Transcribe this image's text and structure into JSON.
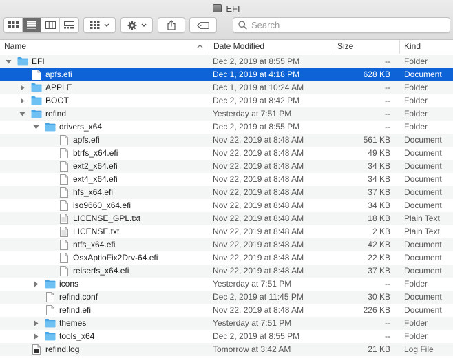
{
  "window": {
    "title": "EFI"
  },
  "toolbar": {
    "search_placeholder": "Search"
  },
  "columns": {
    "name": "Name",
    "date": "Date Modified",
    "size": "Size",
    "kind": "Kind"
  },
  "accent": "#0e63d6",
  "rows": [
    {
      "name": "EFI",
      "date": "Dec 2, 2019 at 8:55 PM",
      "size": "--",
      "kind": "Folder",
      "level": 0,
      "type": "folder",
      "expand": "open"
    },
    {
      "name": "apfs.efi",
      "date": "Dec 1, 2019 at 4:18 PM",
      "size": "628 KB",
      "kind": "Document",
      "level": 1,
      "type": "doc",
      "expand": "none",
      "selected": true
    },
    {
      "name": "APPLE",
      "date": "Dec 1, 2019 at 10:24 AM",
      "size": "--",
      "kind": "Folder",
      "level": 1,
      "type": "folder",
      "expand": "closed"
    },
    {
      "name": "BOOT",
      "date": "Dec 2, 2019 at 8:42 PM",
      "size": "--",
      "kind": "Folder",
      "level": 1,
      "type": "folder",
      "expand": "closed"
    },
    {
      "name": "refind",
      "date": "Yesterday at 7:51 PM",
      "size": "--",
      "kind": "Folder",
      "level": 1,
      "type": "folder",
      "expand": "open"
    },
    {
      "name": "drivers_x64",
      "date": "Dec 2, 2019 at 8:55 PM",
      "size": "--",
      "kind": "Folder",
      "level": 2,
      "type": "folder",
      "expand": "open"
    },
    {
      "name": "apfs.efi",
      "date": "Nov 22, 2019 at 8:48 AM",
      "size": "561 KB",
      "kind": "Document",
      "level": 3,
      "type": "doc",
      "expand": "none"
    },
    {
      "name": "btrfs_x64.efi",
      "date": "Nov 22, 2019 at 8:48 AM",
      "size": "49 KB",
      "kind": "Document",
      "level": 3,
      "type": "doc",
      "expand": "none"
    },
    {
      "name": "ext2_x64.efi",
      "date": "Nov 22, 2019 at 8:48 AM",
      "size": "34 KB",
      "kind": "Document",
      "level": 3,
      "type": "doc",
      "expand": "none"
    },
    {
      "name": "ext4_x64.efi",
      "date": "Nov 22, 2019 at 8:48 AM",
      "size": "34 KB",
      "kind": "Document",
      "level": 3,
      "type": "doc",
      "expand": "none"
    },
    {
      "name": "hfs_x64.efi",
      "date": "Nov 22, 2019 at 8:48 AM",
      "size": "37 KB",
      "kind": "Document",
      "level": 3,
      "type": "doc",
      "expand": "none"
    },
    {
      "name": "iso9660_x64.efi",
      "date": "Nov 22, 2019 at 8:48 AM",
      "size": "34 KB",
      "kind": "Document",
      "level": 3,
      "type": "doc",
      "expand": "none"
    },
    {
      "name": "LICENSE_GPL.txt",
      "date": "Nov 22, 2019 at 8:48 AM",
      "size": "18 KB",
      "kind": "Plain Text",
      "level": 3,
      "type": "text",
      "expand": "none"
    },
    {
      "name": "LICENSE.txt",
      "date": "Nov 22, 2019 at 8:48 AM",
      "size": "2 KB",
      "kind": "Plain Text",
      "level": 3,
      "type": "text",
      "expand": "none"
    },
    {
      "name": "ntfs_x64.efi",
      "date": "Nov 22, 2019 at 8:48 AM",
      "size": "42 KB",
      "kind": "Document",
      "level": 3,
      "type": "doc",
      "expand": "none"
    },
    {
      "name": "OsxAptioFix2Drv-64.efi",
      "date": "Nov 22, 2019 at 8:48 AM",
      "size": "22 KB",
      "kind": "Document",
      "level": 3,
      "type": "doc",
      "expand": "none"
    },
    {
      "name": "reiserfs_x64.efi",
      "date": "Nov 22, 2019 at 8:48 AM",
      "size": "37 KB",
      "kind": "Document",
      "level": 3,
      "type": "doc",
      "expand": "none"
    },
    {
      "name": "icons",
      "date": "Yesterday at 7:51 PM",
      "size": "--",
      "kind": "Folder",
      "level": 2,
      "type": "folder",
      "expand": "closed"
    },
    {
      "name": "refind.conf",
      "date": "Dec 2, 2019 at 11:45 PM",
      "size": "30 KB",
      "kind": "Document",
      "level": 2,
      "type": "doc",
      "expand": "none"
    },
    {
      "name": "refind.efi",
      "date": "Nov 22, 2019 at 8:48 AM",
      "size": "226 KB",
      "kind": "Document",
      "level": 2,
      "type": "doc",
      "expand": "none"
    },
    {
      "name": "themes",
      "date": "Yesterday at 7:51 PM",
      "size": "--",
      "kind": "Folder",
      "level": 2,
      "type": "folder",
      "expand": "closed"
    },
    {
      "name": "tools_x64",
      "date": "Dec 2, 2019 at 8:55 PM",
      "size": "--",
      "kind": "Folder",
      "level": 2,
      "type": "folder",
      "expand": "closed"
    },
    {
      "name": "refind.log",
      "date": "Tomorrow at 3:42 AM",
      "size": "21 KB",
      "kind": "Log File",
      "level": 1,
      "type": "log",
      "expand": "none"
    }
  ]
}
